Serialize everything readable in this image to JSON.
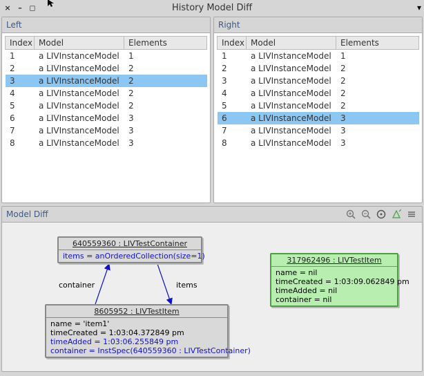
{
  "title": "History Model Diff",
  "panes": {
    "left": {
      "label": "Left"
    },
    "right": {
      "label": "Right"
    }
  },
  "columns": {
    "index": "Index",
    "model": "Model",
    "elements": "Elements"
  },
  "leftRows": [
    {
      "i": "1",
      "m": "a LIVInstanceModel",
      "e": "1"
    },
    {
      "i": "2",
      "m": "a LIVInstanceModel",
      "e": "2"
    },
    {
      "i": "3",
      "m": "a LIVInstanceModel",
      "e": "2"
    },
    {
      "i": "4",
      "m": "a LIVInstanceModel",
      "e": "2"
    },
    {
      "i": "5",
      "m": "a LIVInstanceModel",
      "e": "2"
    },
    {
      "i": "6",
      "m": "a LIVInstanceModel",
      "e": "3"
    },
    {
      "i": "7",
      "m": "a LIVInstanceModel",
      "e": "3"
    },
    {
      "i": "8",
      "m": "a LIVInstanceModel",
      "e": "3"
    }
  ],
  "leftSelected": 2,
  "rightRows": [
    {
      "i": "1",
      "m": "a LIVInstanceModel",
      "e": "1"
    },
    {
      "i": "2",
      "m": "a LIVInstanceModel",
      "e": "2"
    },
    {
      "i": "3",
      "m": "a LIVInstanceModel",
      "e": "2"
    },
    {
      "i": "4",
      "m": "a LIVInstanceModel",
      "e": "2"
    },
    {
      "i": "5",
      "m": "a LIVInstanceModel",
      "e": "2"
    },
    {
      "i": "6",
      "m": "a LIVInstanceModel",
      "e": "3"
    },
    {
      "i": "7",
      "m": "a LIVInstanceModel",
      "e": "3"
    },
    {
      "i": "8",
      "m": "a LIVInstanceModel",
      "e": "3"
    }
  ],
  "rightSelected": 5,
  "diff": {
    "label": "Model Diff",
    "node1": {
      "title": "640559360 : LIVTestContainer",
      "attr1": "items = anOrderedCollection(size=1)"
    },
    "node2": {
      "title": "8605952 : LIVTestItem",
      "attr1": "name = 'item1'",
      "attr2": "timeCreated = 1:03:04.372849 pm",
      "attr3": "timeAdded = 1:03:06.255849 pm",
      "attr4": "container = InstSpec(640559360 : LIVTestContainer)"
    },
    "node3": {
      "title": "317962496 : LIVTestItem",
      "attr1": "name = nil",
      "attr2": "timeCreated = 1:03:09.062849 pm",
      "attr3": "timeAdded = nil",
      "attr4": "container = nil"
    },
    "edge1": "container",
    "edge2": "items"
  }
}
